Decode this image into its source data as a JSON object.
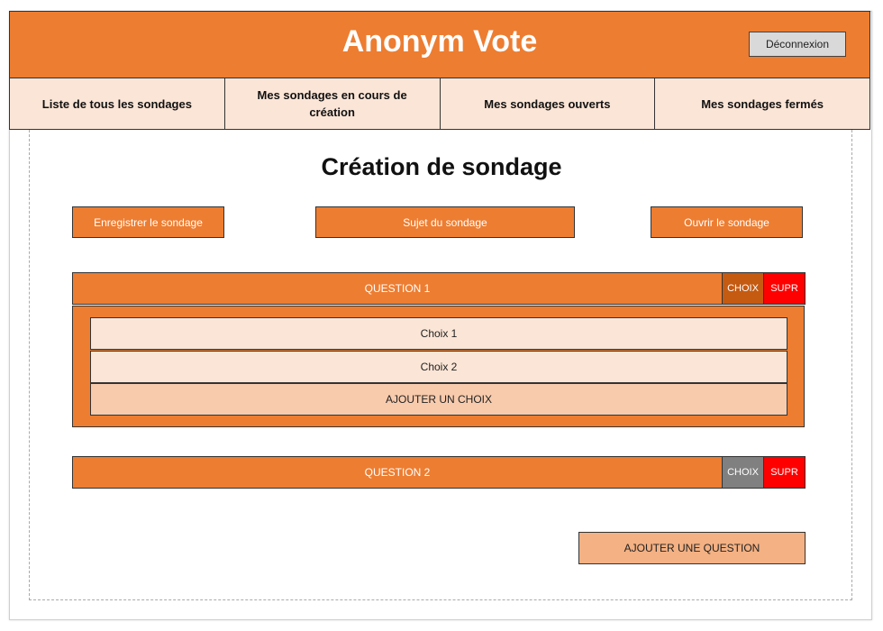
{
  "header": {
    "title": "Anonym Vote",
    "logout_label": "Déconnexion"
  },
  "nav": {
    "tabs": [
      {
        "label": "Liste de tous les sondages"
      },
      {
        "label": "Mes sondages en cours de création"
      },
      {
        "label": "Mes sondages ouverts"
      },
      {
        "label": "Mes sondages fermés"
      }
    ]
  },
  "main": {
    "title": "Création de sondage",
    "actions": {
      "save_label": "Enregistrer le sondage",
      "subject_label": "Sujet du sondage",
      "open_label": "Ouvrir le sondage"
    },
    "questions": [
      {
        "label": "QUESTION 1",
        "choice_button": "CHOIX",
        "delete_button": "SUPR",
        "choice_button_color": "#c55a11",
        "choices": [
          {
            "label": "Choix 1"
          },
          {
            "label": "Choix 2"
          }
        ],
        "add_choice_label": "AJOUTER UN CHOIX"
      },
      {
        "label": "QUESTION 2",
        "choice_button": "CHOIX",
        "delete_button": "SUPR",
        "choice_button_color": "#808080"
      }
    ],
    "add_question_label": "AJOUTER UNE QUESTION"
  },
  "colors": {
    "accent": "#ed7d31",
    "light": "#fbe5d6",
    "danger": "#ff0000"
  }
}
